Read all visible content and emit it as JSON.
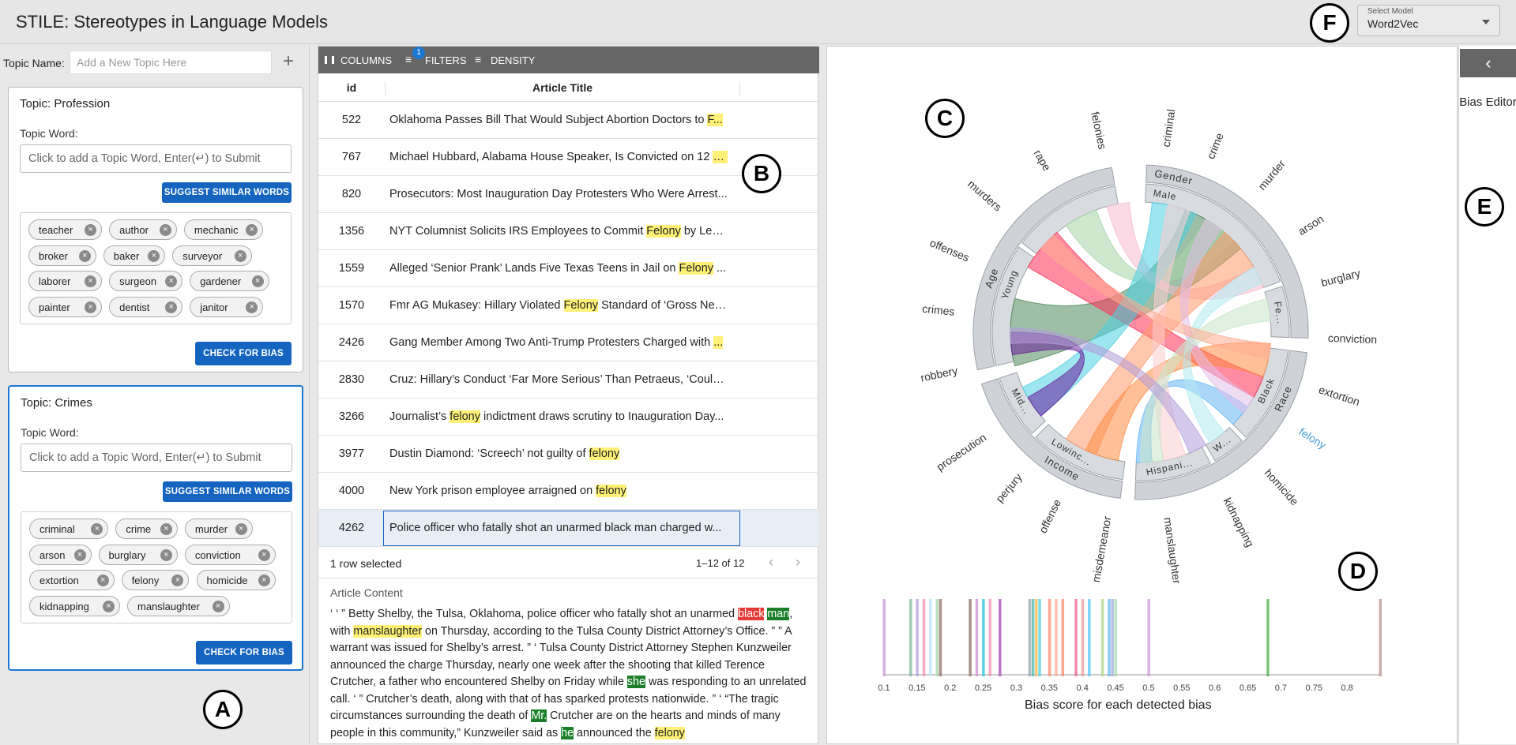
{
  "app": {
    "title": "STILE: Stereotypes in Language Models"
  },
  "model": {
    "label": "Select Model",
    "value": "Word2Vec"
  },
  "annotations": {
    "a": "A",
    "b": "B",
    "c": "C",
    "d": "D",
    "e": "E",
    "f": "F"
  },
  "topic_name": {
    "label": "Topic Name:",
    "placeholder": "Add a New Topic Here",
    "add_icon": "+"
  },
  "topics": [
    {
      "title": "Topic: Profession",
      "word_label": "Topic Word:",
      "input_placeholder": "Click to add a Topic Word, Enter(↵) to Submit",
      "suggest_label": "SUGGEST SIMILAR WORDS",
      "check_label": "CHECK FOR BIAS",
      "words": [
        "teacher",
        "author",
        "mechanic",
        "broker",
        "baker",
        "surveyor",
        "laborer",
        "surgeon",
        "gardener",
        "painter",
        "dentist",
        "janitor"
      ]
    },
    {
      "title": "Topic: Crimes",
      "word_label": "Topic Word:",
      "input_placeholder": "Click to add a Topic Word, Enter(↵) to Submit",
      "suggest_label": "SUGGEST SIMILAR WORDS",
      "check_label": "CHECK FOR BIAS",
      "words": [
        "criminal",
        "crime",
        "murder",
        "arson",
        "burglary",
        "conviction",
        "extortion",
        "felony",
        "homicide",
        "kidnapping",
        "manslaughter"
      ]
    }
  ],
  "table": {
    "toolbar": {
      "columns": "COLUMNS",
      "filters": "FILTERS",
      "filters_badge": "1",
      "density": "DENSITY"
    },
    "headers": {
      "id": "id",
      "title": "Article Title"
    },
    "rows": [
      {
        "id": "522",
        "pre": "Oklahoma Passes Bill That Would Subject Abortion Doctors to ",
        "hl": "F...",
        "post": ""
      },
      {
        "id": "767",
        "pre": "Michael Hubbard, Alabama House Speaker, Is Convicted on 12 ",
        "hl": "F...",
        "post": ""
      },
      {
        "id": "820",
        "pre": "Prosecutors: Most Inauguration Day Protesters Who Were Arrest...",
        "hl": "",
        "post": ""
      },
      {
        "id": "1356",
        "pre": "NYT Columnist Solicits IRS Employees to Commit ",
        "hl": "Felony",
        "post": " by Lea..."
      },
      {
        "id": "1559",
        "pre": "Alleged ‘Senior Prank’ Lands Five Texas Teens in Jail on ",
        "hl": "Felony",
        "post": " ..."
      },
      {
        "id": "1570",
        "pre": "Fmr AG Mukasey: Hillary Violated ",
        "hl": "Felony",
        "post": " Standard of ‘Gross Neg..."
      },
      {
        "id": "2426",
        "pre": "Gang Member Among Two Anti-Trump Protesters Charged with ",
        "hl": "...",
        "post": ""
      },
      {
        "id": "2830",
        "pre": "Cruz: Hillary’s Conduct ‘Far More Serious’ Than Petraeus, ‘Could ...",
        "hl": "",
        "post": ""
      },
      {
        "id": "3266",
        "pre": "Journalist’s ",
        "hl": "felony",
        "post": " indictment draws scrutiny to Inauguration Day..."
      },
      {
        "id": "3977",
        "pre": "Dustin Diamond: ‘Screech’ not guilty of ",
        "hl": "felony",
        "post": ""
      },
      {
        "id": "4000",
        "pre": "New York prison employee arraigned on ",
        "hl": "felony",
        "post": ""
      },
      {
        "id": "4262",
        "pre": "Police officer who fatally shot an unarmed black man charged w...",
        "hl": "",
        "post": ""
      }
    ],
    "footer": {
      "selected": "1 row selected",
      "pagination": "1–12 of 12"
    }
  },
  "article": {
    "title": "Article Content",
    "segments": [
      {
        "t": "‘ ‘ ” Betty Shelby, the Tulsa, Oklahoma, police officer who fatally shot an unarmed ",
        "c": ""
      },
      {
        "t": "black",
        "c": "red"
      },
      {
        "t": " ",
        "c": ""
      },
      {
        "t": "man",
        "c": "green"
      },
      {
        "t": ", with ",
        "c": ""
      },
      {
        "t": "manslaughter",
        "c": "hl"
      },
      {
        "t": " on Thursday, according to the Tulsa County District Attorney’s Office. ” ” A warrant was issued for Shelby’s arrest. ” ‘ Tulsa County District Attorney Stephen Kunzweiler announced the charge Thursday, nearly one week after the shooting that killed Terence Crutcher, a father who encountered Shelby on Friday while ",
        "c": ""
      },
      {
        "t": "she",
        "c": "green"
      },
      {
        "t": " was responding to an unrelated call. ‘ ” Crutcher’s death, along with that of has sparked protests nationwide. ” ‘ “The tragic circumstances surrounding the death of ",
        "c": ""
      },
      {
        "t": "Mr.",
        "c": "green"
      },
      {
        "t": " Crutcher are on the hearts and minds of many people in this community,” Kunzweiler said as ",
        "c": ""
      },
      {
        "t": "he",
        "c": "green"
      },
      {
        "t": " announced the ",
        "c": ""
      },
      {
        "t": "felony",
        "c": "hl"
      }
    ]
  },
  "chord": {
    "groups": [
      "Gender",
      "Male",
      "Fe...",
      "Race",
      "Black",
      "W...",
      "Hispani...",
      "Income",
      "Lowinc...",
      "Mid...",
      "Age",
      "Young"
    ],
    "words": [
      "criminal",
      "crime",
      "murder",
      "arson",
      "burglary",
      "conviction",
      "extortion",
      "felony",
      "homicide",
      "kidnapping",
      "manslaughter",
      "misdemeanor",
      "offense",
      "perjury",
      "prosecution",
      "robbery",
      "crimes",
      "offenses",
      "murders",
      "rape",
      "felonies"
    ],
    "highlight_word": "felony",
    "highlight_color": "#4a9fd8"
  },
  "bias_axis": {
    "label": "Bias score for each detected bias",
    "ticks": [
      "0.1",
      "0.15",
      "0.2",
      "0.25",
      "0.3",
      "0.35",
      "0.4",
      "0.45",
      "0.5",
      "0.55",
      "0.6",
      "0.65",
      "0.7",
      "0.75",
      "0.8"
    ],
    "domain": [
      0.1,
      0.85
    ],
    "marks": [
      {
        "v": 0.1,
        "c": "#c994d4"
      },
      {
        "v": 0.14,
        "c": "#7fb89a"
      },
      {
        "v": 0.15,
        "c": "#b39ddb"
      },
      {
        "v": 0.16,
        "c": "#f48fb1"
      },
      {
        "v": 0.17,
        "c": "#b3e5fc"
      },
      {
        "v": 0.18,
        "c": "#a5d6a7"
      },
      {
        "v": 0.185,
        "c": "#8d6e63"
      },
      {
        "v": 0.23,
        "c": "#8d6e63"
      },
      {
        "v": 0.24,
        "c": "#c994d4"
      },
      {
        "v": 0.25,
        "c": "#26c6da"
      },
      {
        "v": 0.26,
        "c": "#f48fb1"
      },
      {
        "v": 0.275,
        "c": "#ab47bc"
      },
      {
        "v": 0.32,
        "c": "#90a4ae"
      },
      {
        "v": 0.325,
        "c": "#4db6ac"
      },
      {
        "v": 0.33,
        "c": "#ffb74d"
      },
      {
        "v": 0.335,
        "c": "#4dd0e1"
      },
      {
        "v": 0.35,
        "c": "#ff8a65"
      },
      {
        "v": 0.36,
        "c": "#ffab91"
      },
      {
        "v": 0.37,
        "c": "#ff8a65"
      },
      {
        "v": 0.39,
        "c": "#f06292"
      },
      {
        "v": 0.4,
        "c": "#ef9a9a"
      },
      {
        "v": 0.41,
        "c": "#4fc3f7"
      },
      {
        "v": 0.43,
        "c": "#aed581"
      },
      {
        "v": 0.44,
        "c": "#64b5f6"
      },
      {
        "v": 0.445,
        "c": "#9fa8da"
      },
      {
        "v": 0.45,
        "c": "#a5d6a7"
      },
      {
        "v": 0.5,
        "c": "#ce93d8"
      },
      {
        "v": 0.68,
        "c": "#4caf50"
      },
      {
        "v": 0.85,
        "c": "#bc8f8f"
      }
    ]
  },
  "editor": {
    "back_icon": "‹",
    "label": "Bias Editor"
  }
}
